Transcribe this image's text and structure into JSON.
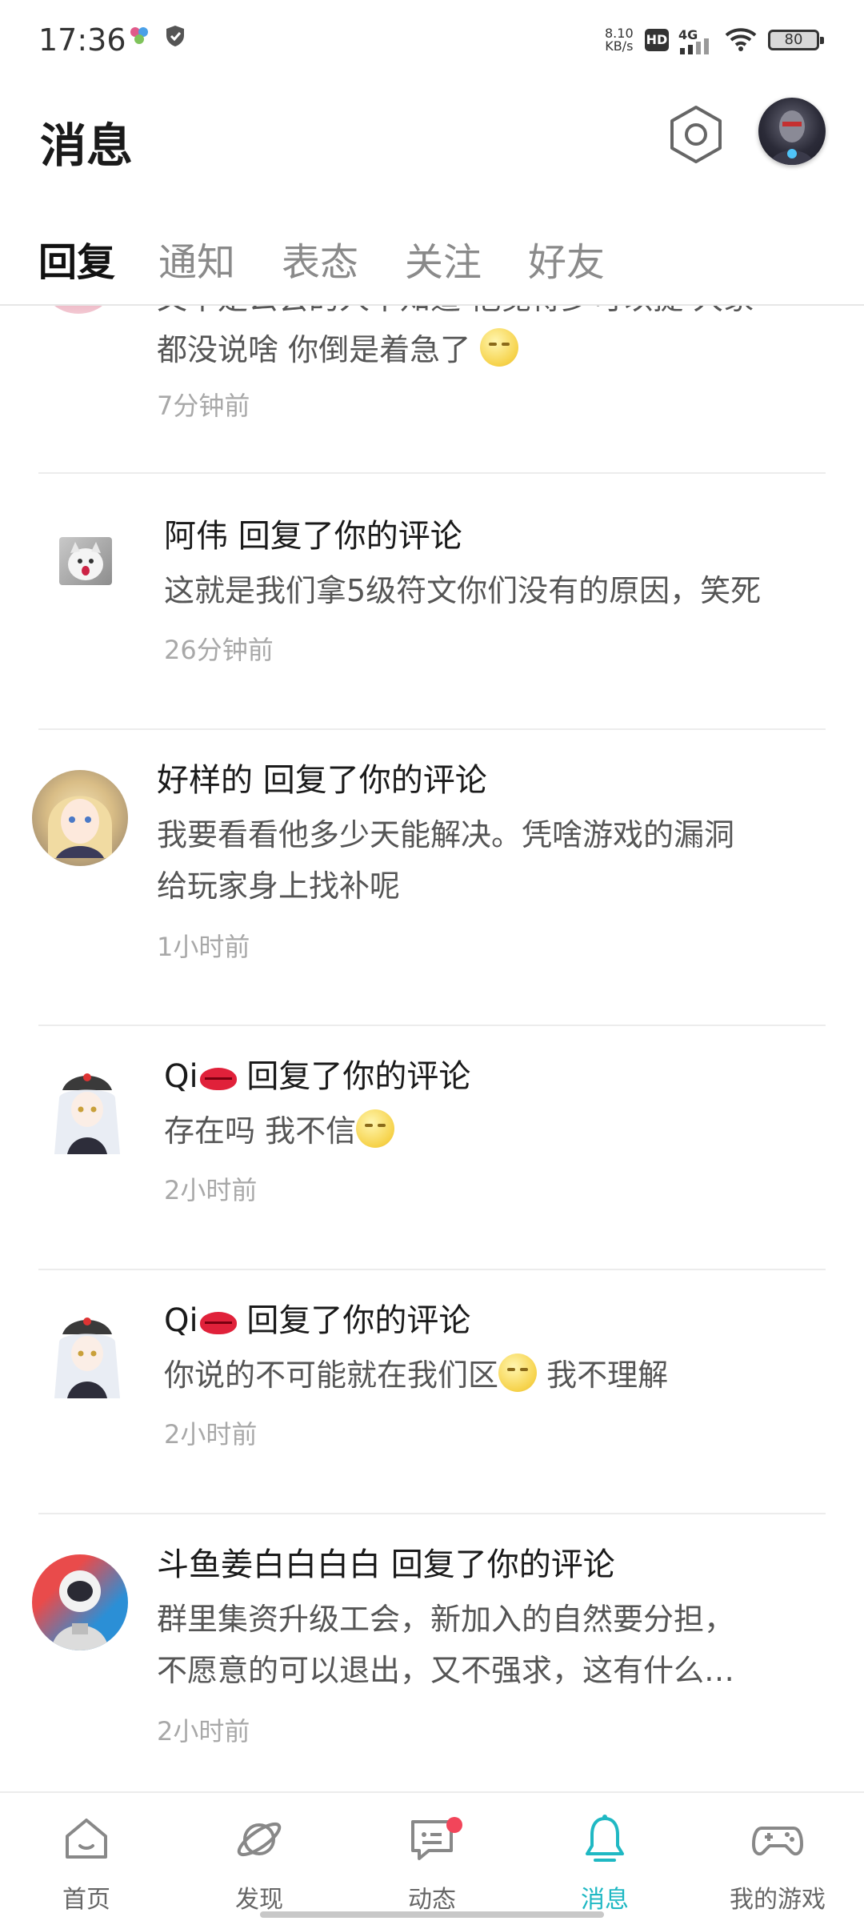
{
  "status_bar": {
    "time": "17:36",
    "speed_value": "8.10",
    "speed_unit": "KB/s",
    "hd": "HD",
    "network": "4G",
    "battery": "80"
  },
  "header": {
    "title": "消息"
  },
  "tabs": [
    {
      "label": "回复",
      "active": true
    },
    {
      "label": "通知",
      "active": false
    },
    {
      "label": "表态",
      "active": false
    },
    {
      "label": "关注",
      "active": false
    },
    {
      "label": "好友",
      "active": false
    }
  ],
  "messages": [
    {
      "body_lines": [
        "又不是公会的人不知道 他觉得少可以提 大家",
        "都没说啥 你倒是着急了"
      ],
      "time": "7分钟前"
    },
    {
      "name": "阿伟",
      "action": "回复了你的评论",
      "body_lines": [
        "这就是我们拿5级符文你们没有的原因，笑死"
      ],
      "time": "26分钟前"
    },
    {
      "name": "好样的",
      "action": "回复了你的评论",
      "body_lines": [
        "我要看看他多少天能解决。凭啥游戏的漏洞",
        "给玩家身上找补呢"
      ],
      "time": "1小时前"
    },
    {
      "name": "Qi",
      "action": "回复了你的评论",
      "body_lines": [
        "存在吗 我不信"
      ],
      "time": "2小时前"
    },
    {
      "name": "Qi",
      "action": "回复了你的评论",
      "body_lines": [
        "你说的不可能就在我们区",
        "我不理解"
      ],
      "time": "2小时前"
    },
    {
      "name": "斗鱼姜白白白白",
      "action": "回复了你的评论",
      "body_lines": [
        "群里集资升级工会，新加入的自然要分担，",
        "不愿意的可以退出，又不强求，这有什么…"
      ],
      "time": "2小时前"
    }
  ],
  "bottom_nav": [
    {
      "label": "首页",
      "icon": "home-icon",
      "active": false
    },
    {
      "label": "发现",
      "icon": "planet-icon",
      "active": false
    },
    {
      "label": "动态",
      "icon": "chat-icon",
      "active": false,
      "badge": true
    },
    {
      "label": "消息",
      "icon": "bell-icon",
      "active": true
    },
    {
      "label": "我的游戏",
      "icon": "gamepad-icon",
      "active": false
    }
  ],
  "colors": {
    "accent": "#1fb8c3",
    "badge": "#f2455a",
    "text_primary": "#1a1a1a",
    "text_secondary": "#555555",
    "text_time": "#a8a8a8"
  }
}
